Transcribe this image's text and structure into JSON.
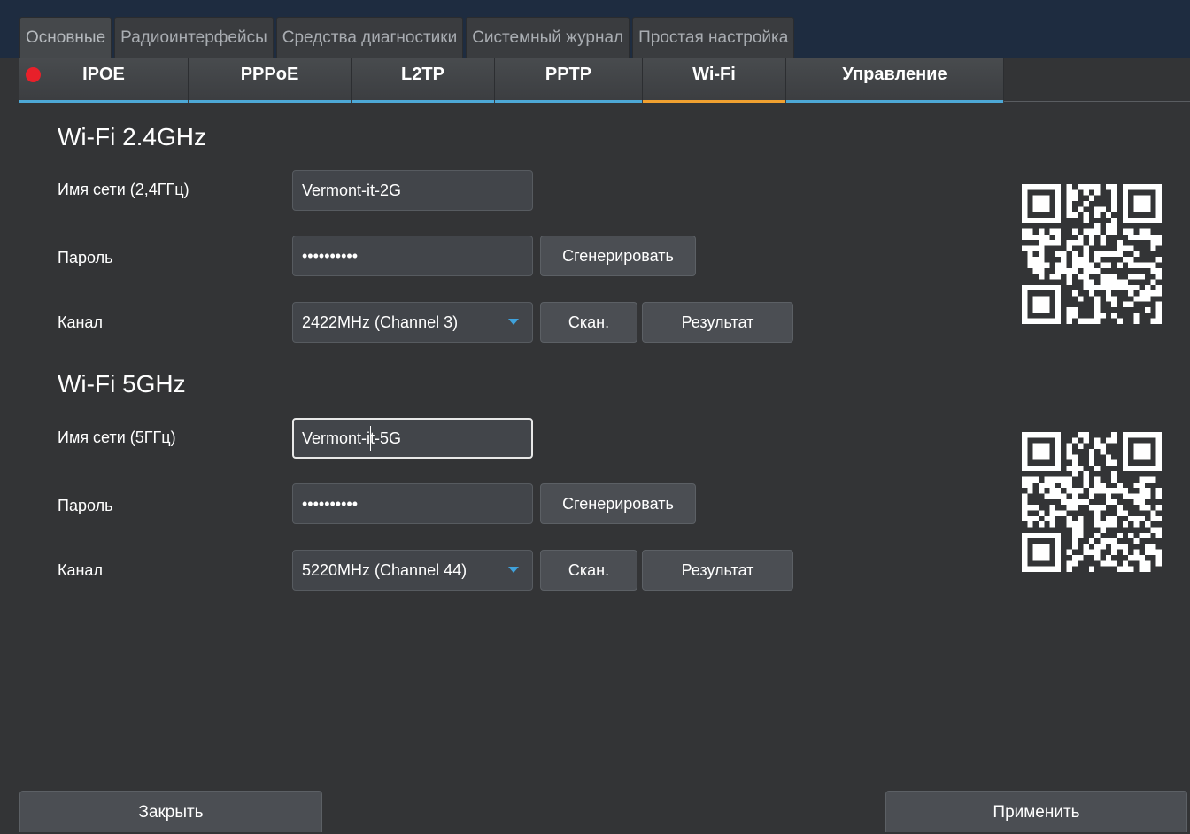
{
  "main_tabs": [
    "Основные",
    "Радиоинтерфейсы",
    "Средства диагностики",
    "Системный журнал",
    "Простая настройка"
  ],
  "sub_tabs": [
    "IPOE",
    "PPPoE",
    "L2TP",
    "PPTP",
    "Wi-Fi",
    "Управление"
  ],
  "active_sub_tab": "Wi-Fi",
  "wifi24": {
    "title": "Wi-Fi 2.4GHz",
    "ssid_label": "Имя сети (2,4ГГц)",
    "ssid_value": "Vermont-it-2G",
    "password_label": "Пароль",
    "password_value": "••••••••••",
    "generate_label": "Сгенерировать",
    "channel_label": "Канал",
    "channel_value": "2422MHz (Channel 3)",
    "scan_label": "Скан.",
    "result_label": "Результат"
  },
  "wifi5": {
    "title": "Wi-Fi 5GHz",
    "ssid_label": "Имя сети (5ГГц)",
    "ssid_value": "Vermont-it-5G",
    "password_label": "Пароль",
    "password_value": "••••••••••",
    "generate_label": "Сгенерировать",
    "channel_label": "Канал",
    "channel_value": "5220MHz (Channel 44)",
    "scan_label": "Скан.",
    "result_label": "Результат"
  },
  "footer": {
    "close_label": "Закрыть",
    "apply_label": "Применить"
  },
  "colors": {
    "accent_active": "#f0a030",
    "accent": "#4da8d6",
    "status_dot": "#e8202a",
    "header": "#1e2c40"
  },
  "icons": {
    "status": "red-dot-icon",
    "dropdown": "chevron-down-icon",
    "qr": "qr-code-icon"
  }
}
